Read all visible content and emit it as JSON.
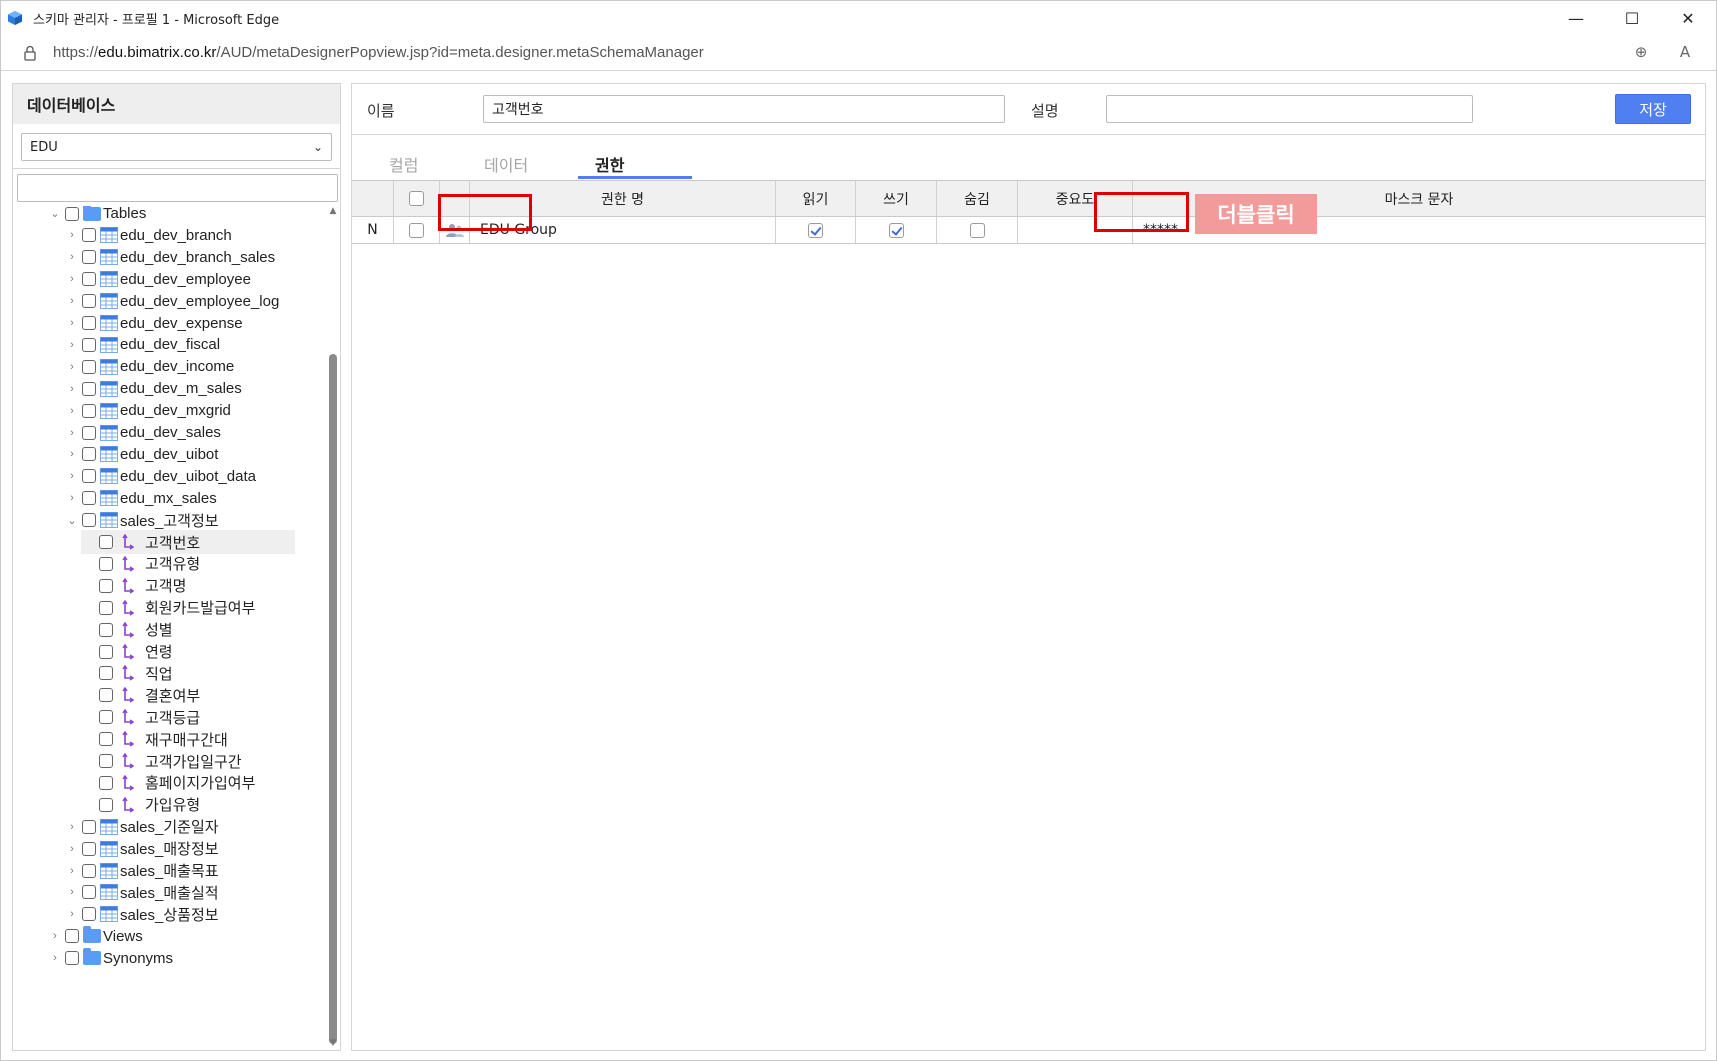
{
  "window": {
    "title": "스키마 관리자 - 프로필 1 - Microsoft Edge",
    "url_prefix": "https://",
    "url_host": "edu.bimatrix.co.kr",
    "url_path": "/AUD/metaDesignerPopview.jsp?id=meta.designer.metaSchemaManager",
    "minimize": "—",
    "maximize": "☐",
    "close": "✕",
    "zoom_icon": "⊕",
    "read_aloud_icon": "A"
  },
  "left": {
    "header": "데이터베이스",
    "db_selected": "EDU",
    "search_placeholder": "",
    "tables_folder": "Tables",
    "tables": [
      "edu_dev_branch",
      "edu_dev_branch_sales",
      "edu_dev_employee",
      "edu_dev_employee_log",
      "edu_dev_expense",
      "edu_dev_fiscal",
      "edu_dev_income",
      "edu_dev_m_sales",
      "edu_dev_mxgrid",
      "edu_dev_sales",
      "edu_dev_uibot",
      "edu_dev_uibot_data",
      "edu_mx_sales"
    ],
    "expanded_table": "sales_고객정보",
    "columns": [
      "고객번호",
      "고객유형",
      "고객명",
      "회원카드발급여부",
      "성별",
      "연령",
      "직업",
      "결혼여부",
      "고객등급",
      "재구매구간대",
      "고객가입일구간",
      "홈페이지가입여부",
      "가입유형"
    ],
    "more_tables": [
      "sales_기준일자",
      "sales_매장정보",
      "sales_매출목표",
      "sales_매출실적",
      "sales_상품정보"
    ],
    "views_folder": "Views",
    "synonyms_folder": "Synonyms"
  },
  "form": {
    "name_label": "이름",
    "name_value": "고객번호",
    "desc_label": "설명",
    "desc_value": "",
    "save_label": "저장"
  },
  "tabs": [
    "컬럼",
    "데이터",
    "권한"
  ],
  "active_tab": "권한",
  "grid": {
    "headers": [
      "권한 명",
      "읽기",
      "쓰기",
      "숨김",
      "중요도",
      "마스크 문자"
    ],
    "row": {
      "state": "N",
      "name": "EDU Group",
      "read": true,
      "write": true,
      "hide": false,
      "importance": "",
      "mask": "*****"
    }
  },
  "annotation": {
    "double_click_label": "더블클릭",
    "highlight_color": "#e00000",
    "label_color": "#f39a9a"
  },
  "colors": {
    "accent": "#4f7ff0",
    "folder": "#5a9cf5",
    "column_icon": "#8a3fd1"
  }
}
